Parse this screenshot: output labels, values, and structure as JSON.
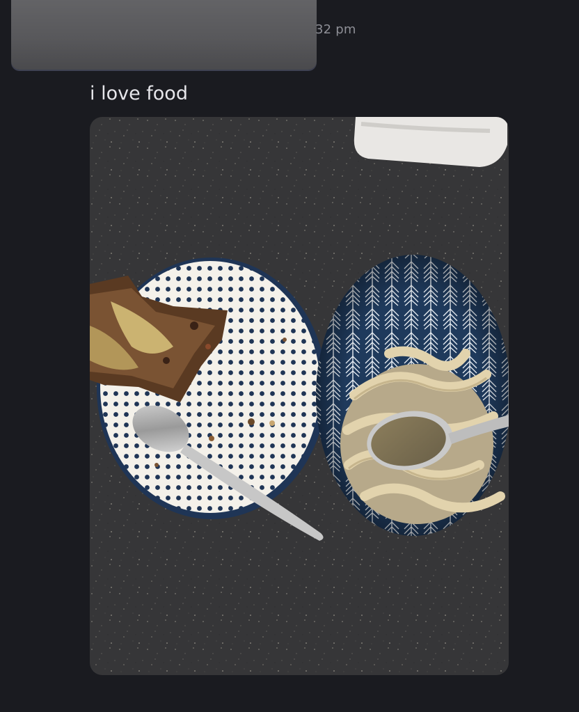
{
  "header": {
    "timestamp": "32 pm"
  },
  "message": {
    "text": "i love food",
    "attachment": {
      "type": "photo",
      "icon": "photo-attachment"
    }
  }
}
